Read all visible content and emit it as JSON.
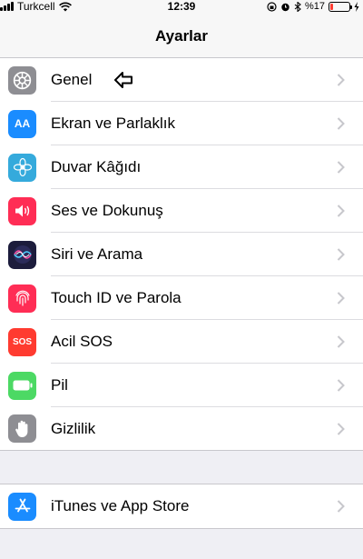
{
  "status_bar": {
    "carrier": "Turkcell",
    "time": "12:39",
    "battery_text": "%17",
    "battery_level": 0.17
  },
  "nav": {
    "title": "Ayarlar"
  },
  "settings": [
    {
      "label": "Genel",
      "icon": "gear-icon",
      "color": "#8e8e93"
    },
    {
      "label": "Ekran ve Parlaklık",
      "icon": "text-size-icon",
      "color": "#1a8cff",
      "icon_text": "AA"
    },
    {
      "label": "Duvar Kâğıdı",
      "icon": "wallpaper-flower-icon",
      "color": "#35aadc"
    },
    {
      "label": "Ses ve Dokunuş",
      "icon": "speaker-icon",
      "color": "#ff2d55"
    },
    {
      "label": "Siri ve Arama",
      "icon": "siri-icon",
      "color": "#1c1c3c"
    },
    {
      "label": "Touch ID ve Parola",
      "icon": "fingerprint-icon",
      "color": "#ff2d55"
    },
    {
      "label": "Acil SOS",
      "icon": "sos-icon",
      "color": "#ff3b30",
      "icon_text": "SOS"
    },
    {
      "label": "Pil",
      "icon": "battery-icon",
      "color": "#4cd964"
    },
    {
      "label": "Gizlilik",
      "icon": "privacy-hand-icon",
      "color": "#8e8e93"
    }
  ],
  "store": [
    {
      "label": "iTunes ve App Store",
      "icon": "app-store-icon",
      "color": "#1a8cff"
    }
  ]
}
